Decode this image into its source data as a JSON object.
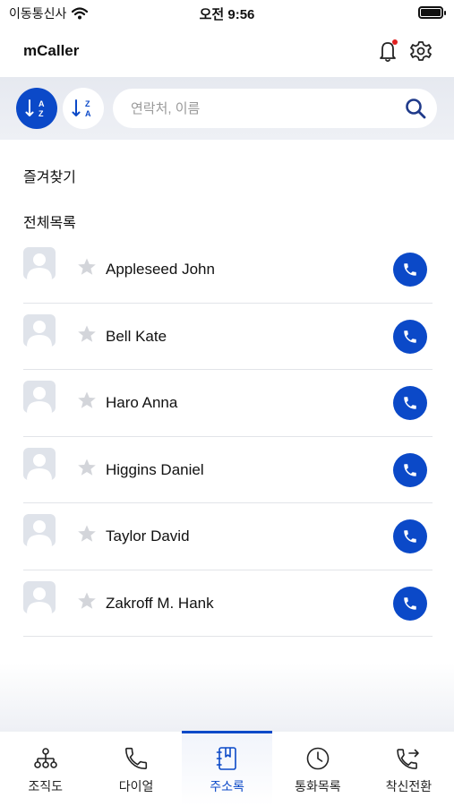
{
  "status_bar": {
    "carrier": "이동통신사",
    "time": "오전 9:56"
  },
  "header": {
    "title": "mCaller",
    "notification_dot_color": "#e02020"
  },
  "search": {
    "placeholder": "연락처, 이름",
    "sort_az_icon": "sort-a-z-icon",
    "sort_za_icon": "sort-z-a-icon"
  },
  "sections": {
    "favorites": "즐겨찾기",
    "all_list": "전체목록"
  },
  "contacts": [
    {
      "name": "Appleseed John",
      "favorite": false
    },
    {
      "name": "Bell Kate",
      "favorite": false
    },
    {
      "name": "Haro Anna",
      "favorite": false
    },
    {
      "name": "Higgins Daniel",
      "favorite": false
    },
    {
      "name": "Taylor David",
      "favorite": false
    },
    {
      "name": "Zakroff M. Hank",
      "favorite": false
    }
  ],
  "tabs": [
    {
      "label": "조직도",
      "icon": "org-chart-icon",
      "active": false
    },
    {
      "label": "다이얼",
      "icon": "phone-icon",
      "active": false
    },
    {
      "label": "주소록",
      "icon": "address-book-icon",
      "active": true
    },
    {
      "label": "통화목록",
      "icon": "clock-icon",
      "active": false
    },
    {
      "label": "착신전환",
      "icon": "call-forward-icon",
      "active": false
    }
  ],
  "colors": {
    "accent": "#0b49c8",
    "search_band": "#e6e9f0",
    "avatar_bg": "#dfe3ea",
    "star": "#d3d5da"
  }
}
